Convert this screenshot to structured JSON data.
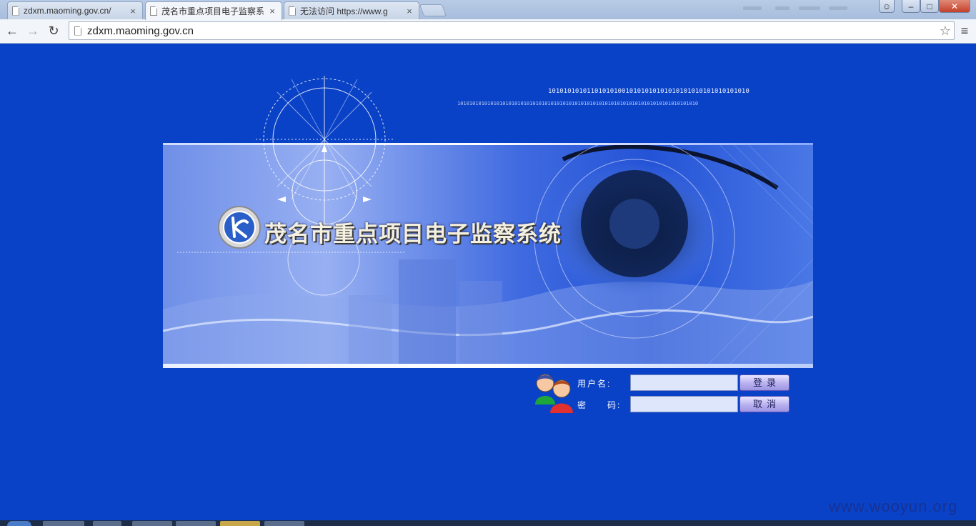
{
  "browser": {
    "tabs": [
      {
        "title": "zdxm.maoming.gov.cn/",
        "active": false
      },
      {
        "title": "茂名市重点项目电子监察系",
        "active": true
      },
      {
        "title": "无法访问 https://www.g",
        "active": false
      }
    ],
    "close_glyph": "×",
    "address": "zdxm.maoming.gov.cn",
    "nav": {
      "back": "←",
      "forward": "→",
      "reload": "↻",
      "star": "☆",
      "menu": "≡"
    },
    "window_controls": {
      "minimize": "–",
      "maximize": "□",
      "close": "✕"
    }
  },
  "banner": {
    "title": "茂名市重点项目电子监察系统",
    "binary_line_1": "1010101010110101010010101010101010101010101010101010",
    "binary_line_2": "10101010101010101010101010101010101010101010101010101010101010101010101010101010"
  },
  "login": {
    "username_label": "用户名:",
    "password_label": "密　　码:",
    "username_value": "",
    "password_value": "",
    "login_button": "登录",
    "cancel_button": "取消"
  },
  "watermark": "www.wooyun.org",
  "colors": {
    "page_background": "#0942c7",
    "input_background": "#dde6fb",
    "button_accent": "#b8b0ef"
  }
}
